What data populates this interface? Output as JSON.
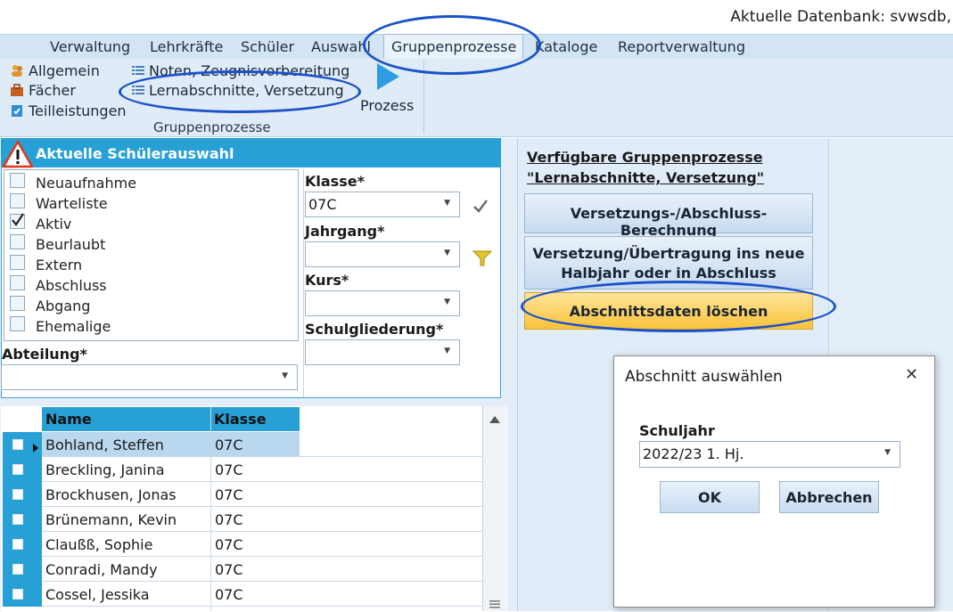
{
  "header": {
    "db_label": "Aktuelle Datenbank: svwsdb,"
  },
  "menu": {
    "items": [
      "Verwaltung",
      "Lehrkräfte",
      "Schüler",
      "Auswahl",
      "Gruppenprozesse",
      "Kataloge",
      "Reportverwaltung"
    ],
    "active": "Gruppenprozesse"
  },
  "ribbon": {
    "col1": [
      "Allgemein",
      "Fächer",
      "Teilleistungen"
    ],
    "col2": [
      "Noten, Zeugnisvorbereitung",
      "Lernabschnitte, Versetzung"
    ],
    "prozess_label": "Prozess",
    "group_label": "Gruppenprozesse"
  },
  "selection": {
    "title": "Aktuelle Schülerauswahl",
    "statuses": [
      {
        "label": "Neuaufnahme",
        "checked": false
      },
      {
        "label": "Warteliste",
        "checked": false
      },
      {
        "label": "Aktiv",
        "checked": true
      },
      {
        "label": "Beurlaubt",
        "checked": false
      },
      {
        "label": "Extern",
        "checked": false
      },
      {
        "label": "Abschluss",
        "checked": false
      },
      {
        "label": "Abgang",
        "checked": false
      },
      {
        "label": "Ehemalige",
        "checked": false
      }
    ],
    "abteilung_label": "Abteilung*",
    "abteilung_value": "",
    "klasse_label": "Klasse*",
    "klasse_value": "07C",
    "jahrgang_label": "Jahrgang*",
    "jahrgang_value": "",
    "kurs_label": "Kurs*",
    "kurs_value": "",
    "schulgliederung_label": "Schulgliederung*",
    "schulgliederung_value": ""
  },
  "grid": {
    "headers": [
      "Name",
      "Klasse"
    ],
    "rows": [
      {
        "name": "Bohland, Steffen",
        "klasse": "07C",
        "current": true
      },
      {
        "name": "Breckling, Janina",
        "klasse": "07C",
        "current": false
      },
      {
        "name": "Brockhusen, Jonas",
        "klasse": "07C",
        "current": false
      },
      {
        "name": "Brünemann, Kevin",
        "klasse": "07C",
        "current": false
      },
      {
        "name": "Claußß, Sophie",
        "klasse": "07C",
        "current": false
      },
      {
        "name": "Conradi, Mandy",
        "klasse": "07C",
        "current": false
      },
      {
        "name": "Cossel, Jessika",
        "klasse": "07C",
        "current": false
      }
    ]
  },
  "processes": {
    "title_line1": "Verfügbare Gruppenprozesse",
    "title_line2": "\"Lernabschnitte, Versetzung\"",
    "buttons": [
      "Versetzungs-/Abschluss-Berechnung",
      "Versetzung/Übertragung ins neue Halbjahr oder in Abschluss",
      "Abschnittsdaten löschen"
    ]
  },
  "dialog": {
    "title": "Abschnitt auswählen",
    "close_glyph": "✕",
    "field_label": "Schuljahr",
    "field_value": "2022/23 1. Hj.",
    "ok_label": "OK",
    "cancel_label": "Abbrechen"
  },
  "colors": {
    "accent_blue": "#27a0d6",
    "highlight_yellow": "#fbd24d",
    "annotation_blue": "#1a52c9"
  }
}
